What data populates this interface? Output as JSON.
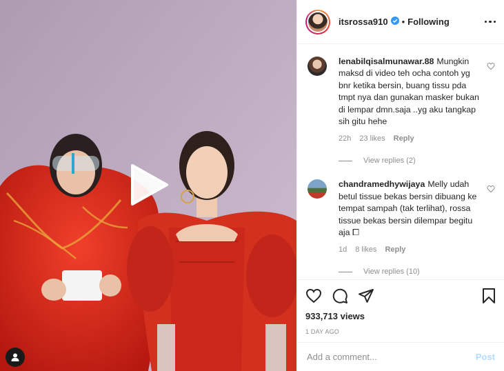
{
  "post": {
    "author": "itsrossa910",
    "follow_status": "Following",
    "separator": "•",
    "more_icon": "more-horizontal-icon",
    "colors": {
      "brand_gradient": [
        "#f09433",
        "#dc2743",
        "#bc1888"
      ],
      "verified": "#3897f0",
      "post_disabled": "#b3dbff",
      "muted": "#8e8e8e"
    }
  },
  "comments": [
    {
      "user": "lenabilqisalmunawar.88",
      "text": "Mungkin maksd di video teh ocha contoh yg bnr ketika bersin, buang tissu pda tmpt nya dan gunakan masker bukan di lempar dmn.saja ..yg aku tangkap sih gitu hehe",
      "time": "22h",
      "likes": "23 likes",
      "reply": "Reply",
      "view_replies": "View replies (2)"
    },
    {
      "user": "chandramedhywijaya",
      "text": "Melly udah betul tissue bekas bersin dibuang ke tempat sampah (tak terlihat), rossa tissue bekas bersin dilempar begitu aja ⧠",
      "time": "1d",
      "likes": "8 likes",
      "reply": "Reply",
      "view_replies": "View replies (10)"
    }
  ],
  "actions": {
    "views": "933,713 views",
    "posted": "1 DAY AGO"
  },
  "composer": {
    "placeholder": "Add a comment...",
    "post_label": "Post"
  }
}
